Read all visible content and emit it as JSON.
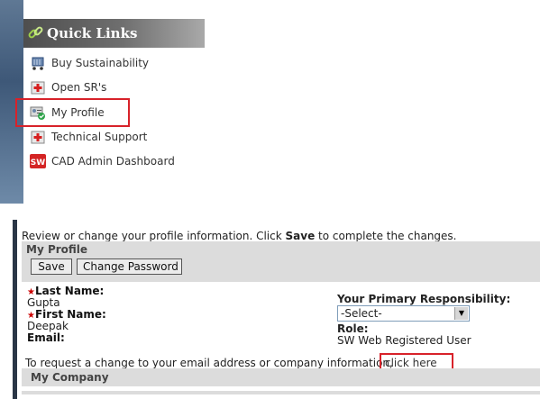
{
  "quick_links": {
    "title": "Quick Links",
    "items": [
      {
        "label": "Buy Sustainability",
        "icon": "shopping-cart-icon"
      },
      {
        "label": "Open SR's",
        "icon": "service-request-icon"
      },
      {
        "label": "My Profile",
        "icon": "profile-icon"
      },
      {
        "label": "Technical Support",
        "icon": "support-icon"
      },
      {
        "label": "CAD Admin Dashboard",
        "icon": "sw-logo-icon"
      }
    ]
  },
  "profile": {
    "instruction_pre": "Review or change your profile information. Click ",
    "instruction_bold": "Save",
    "instruction_post": " to complete the changes.",
    "section_title": "My Profile",
    "save_label": "Save",
    "change_password_label": "Change Password",
    "required_mark": "★",
    "last_name_label": "Last Name:",
    "last_name_value": "Gupta",
    "first_name_label": "First Name:",
    "first_name_value": "Deepak",
    "email_label": "Email:",
    "responsibility_label": "Your Primary Responsibility:",
    "responsibility_value": "-Select-",
    "role_label": "Role:",
    "role_value": "SW Web Registered User",
    "email_change_note": "To request a change to your email address or company information,",
    "click_here": "click here",
    "company_title": "My Company"
  },
  "colors": {
    "highlight": "#d8222a",
    "panel_gray": "#dcdcdc",
    "required_red": "#cc0000"
  }
}
